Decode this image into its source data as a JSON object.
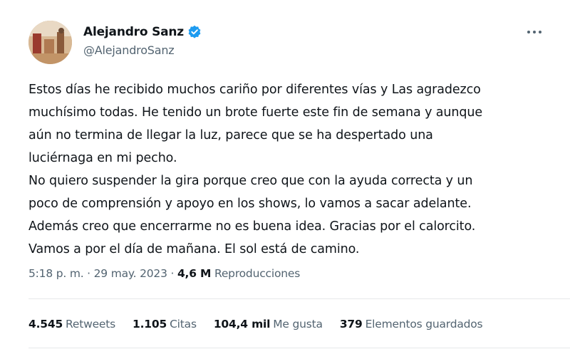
{
  "author": {
    "name": "Alejandro Sanz",
    "handle": "@AlejandroSanz"
  },
  "tweet": {
    "lines": [
      "Estos días he recibido muchos cariño por diferentes vías y Las agradezco",
      "muchísimo todas. He tenido un brote fuerte este fin de semana y aunque",
      "aún no termina de llegar la luz, parece que se ha despertado una",
      "luciérnaga en mi pecho.",
      "No quiero suspender la gira porque creo que con la ayuda correcta y un",
      "poco de comprensión y apoyo en los shows, lo vamos a sacar adelante.",
      "Además creo que encerrarme no es buena idea. Gracias por el calorcito.",
      "Vamos a por el día de mañana. El sol está de camino."
    ]
  },
  "meta": {
    "time": "5:18 p. m.",
    "separator": " · ",
    "date": "29 may. 2023",
    "views_count": "4,6 M",
    "views_label": "Reproducciones"
  },
  "stats": {
    "retweets": {
      "count": "4.545",
      "label": "Retweets"
    },
    "quotes": {
      "count": "1.105",
      "label": "Citas"
    },
    "likes": {
      "count": "104,4 mil",
      "label": "Me gusta"
    },
    "bookmarks": {
      "count": "379",
      "label": "Elementos guardados"
    }
  },
  "icons": {
    "verified": "verified-badge-icon",
    "more": "more-horizontal-icon"
  },
  "colors": {
    "text_primary": "#0f1419",
    "text_secondary": "#536471",
    "verified_blue": "#1d9bf0",
    "divider": "#e7e9ea"
  }
}
